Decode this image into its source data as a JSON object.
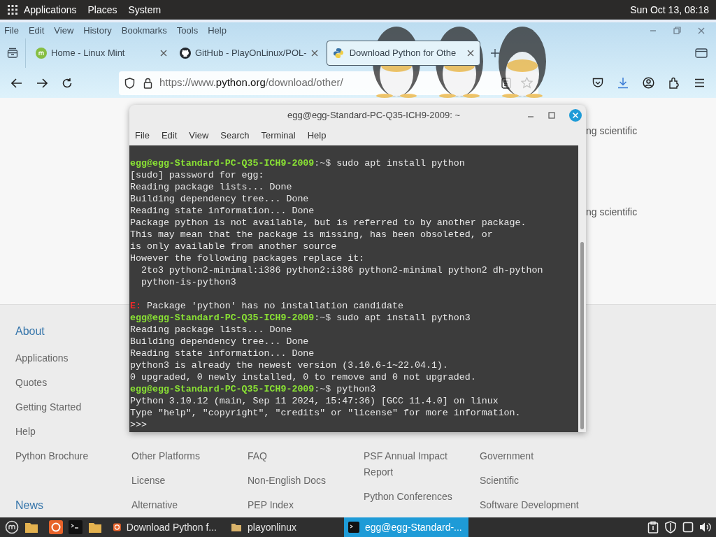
{
  "top_panel": {
    "menus": [
      "Applications",
      "Places",
      "System"
    ],
    "clock": "Sun Oct 13, 08:18"
  },
  "browser": {
    "menu": [
      "File",
      "Edit",
      "View",
      "History",
      "Bookmarks",
      "Tools",
      "Help"
    ],
    "tabs": [
      {
        "label": "Home - Linux Mint",
        "selected": false
      },
      {
        "label": "GitHub - PlayOnLinux/POL-",
        "selected": false
      },
      {
        "label": "Download Python for Othe",
        "selected": true
      }
    ],
    "url": {
      "prefix": "https://www.",
      "domain": "python.org",
      "path": "/download/other/"
    }
  },
  "page": {
    "side_texts": [
      "ng scientific",
      "ng scientific"
    ],
    "footer_columns": [
      {
        "items": [
          {
            "kind": "heading",
            "text": "About"
          },
          {
            "kind": "link",
            "text": "Applications"
          },
          {
            "kind": "link",
            "text": "Quotes"
          },
          {
            "kind": "link",
            "text": "Getting Started"
          },
          {
            "kind": "link",
            "text": "Help"
          },
          {
            "kind": "link",
            "text": "Python Brochure"
          },
          {
            "kind": "heading",
            "text": "News"
          }
        ]
      },
      {
        "items": [
          {
            "kind": "link",
            "text": "Other Platforms"
          },
          {
            "kind": "link",
            "text": "License"
          },
          {
            "kind": "link",
            "text": "Alternative"
          }
        ]
      },
      {
        "items": [
          {
            "kind": "link",
            "text": "FAQ"
          },
          {
            "kind": "link",
            "text": "Non-English Docs"
          },
          {
            "kind": "link",
            "text": "PEP Index"
          }
        ]
      },
      {
        "items": [
          {
            "kind": "link",
            "text": "PSF Annual Impact Report"
          },
          {
            "kind": "link",
            "text": "Python Conferences"
          }
        ]
      },
      {
        "items": [
          {
            "kind": "link",
            "text": "Government"
          },
          {
            "kind": "link",
            "text": "Scientific"
          },
          {
            "kind": "link",
            "text": "Software Development"
          }
        ]
      }
    ]
  },
  "terminal": {
    "title": "egg@egg-Standard-PC-Q35-ICH9-2009: ~",
    "menu": [
      "File",
      "Edit",
      "View",
      "Search",
      "Terminal",
      "Help"
    ],
    "lines": [
      {
        "kind": "prompt",
        "user": "egg@egg-Standard-PC-Q35-ICH9-2009",
        "path": ":~$",
        "command": "sudo apt install python"
      },
      {
        "kind": "output",
        "text": "[sudo] password for egg:"
      },
      {
        "kind": "output",
        "text": "Reading package lists... Done"
      },
      {
        "kind": "output",
        "text": "Building dependency tree... Done"
      },
      {
        "kind": "output",
        "text": "Reading state information... Done"
      },
      {
        "kind": "output",
        "text": "Package python is not available, but is referred to by another package."
      },
      {
        "kind": "output",
        "text": "This may mean that the package is missing, has been obsoleted, or"
      },
      {
        "kind": "output",
        "text": "is only available from another source"
      },
      {
        "kind": "output",
        "text": "However the following packages replace it:"
      },
      {
        "kind": "output",
        "text": "  2to3 python2-minimal:i386 python2:i386 python2-minimal python2 dh-python"
      },
      {
        "kind": "output",
        "text": "  python-is-python3"
      },
      {
        "kind": "blank"
      },
      {
        "kind": "error",
        "tag": "E:",
        "text": "Package 'python' has no installation candidate"
      },
      {
        "kind": "prompt",
        "user": "egg@egg-Standard-PC-Q35-ICH9-2009",
        "path": ":~$",
        "command": "sudo apt install python3"
      },
      {
        "kind": "output",
        "text": "Reading package lists... Done"
      },
      {
        "kind": "output",
        "text": "Building dependency tree... Done"
      },
      {
        "kind": "output",
        "text": "Reading state information... Done"
      },
      {
        "kind": "output",
        "text": "python3 is already the newest version (3.10.6-1~22.04.1)."
      },
      {
        "kind": "output",
        "text": "0 upgraded, 0 newly installed, 0 to remove and 0 not upgraded."
      },
      {
        "kind": "prompt",
        "user": "egg@egg-Standard-PC-Q35-ICH9-2009",
        "path": ":~$",
        "command": "python3"
      },
      {
        "kind": "output",
        "text": "Python 3.10.12 (main, Sep 11 2024, 15:47:36) [GCC 11.4.0] on linux"
      },
      {
        "kind": "output",
        "text": "Type \"help\", \"copyright\", \"credits\" or \"license\" for more information."
      },
      {
        "kind": "output",
        "text": ">>>"
      }
    ]
  },
  "taskbar": {
    "windows": [
      {
        "label": "Download Python f...",
        "selected": false
      },
      {
        "label": "playonlinux",
        "selected": false
      },
      {
        "label": "egg@egg-Standard-...",
        "selected": true
      }
    ]
  }
}
